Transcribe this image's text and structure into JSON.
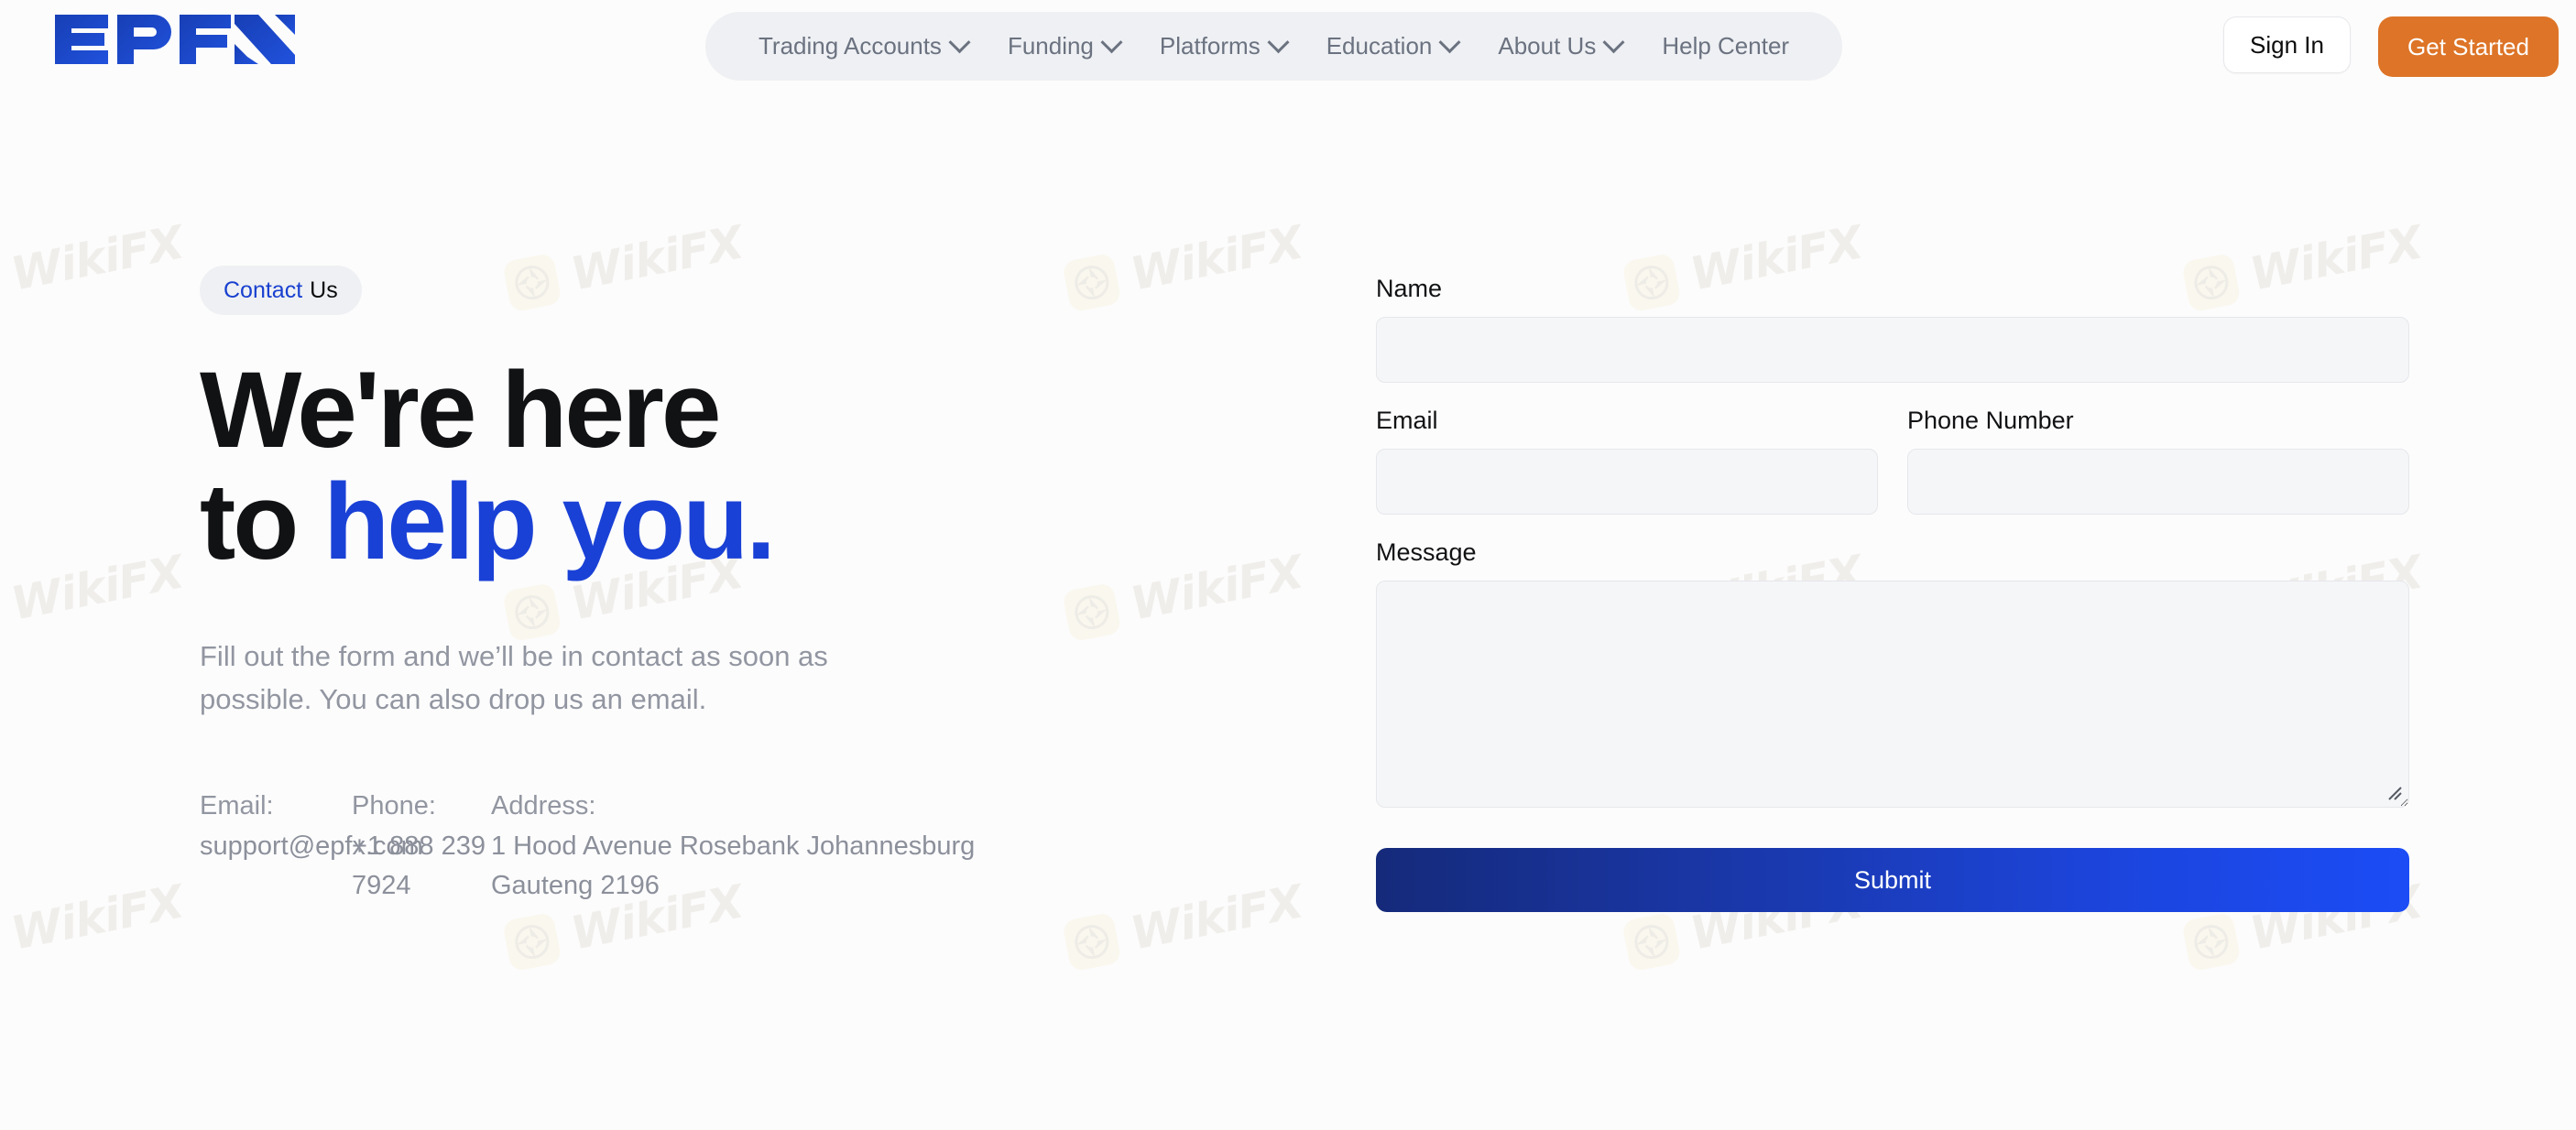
{
  "brand": {
    "logo_text": "EPFX",
    "logo_color": "#1B3FBE",
    "accent_blue": "#1A41D6",
    "accent_orange": "#DD7427",
    "page_background": "#FCFCFC"
  },
  "header": {
    "nav_items": [
      {
        "label": "Trading Accounts",
        "has_chevron": true,
        "icon": "chevron-down-icon"
      },
      {
        "label": "Funding",
        "has_chevron": true,
        "icon": "chevron-down-icon"
      },
      {
        "label": "Platforms",
        "has_chevron": true,
        "icon": "chevron-down-icon"
      },
      {
        "label": "Education",
        "has_chevron": true,
        "icon": "chevron-down-icon"
      },
      {
        "label": "About Us",
        "has_chevron": true,
        "icon": "chevron-down-icon"
      },
      {
        "label": "Help Center",
        "has_chevron": false,
        "icon": ""
      }
    ],
    "sign_in_label": "Sign In",
    "get_started_label": "Get Started"
  },
  "hero": {
    "badge_blue": "Contact",
    "badge_dark": "Us",
    "headline_line1": "We're here",
    "headline_line2_dark": "to ",
    "headline_line2_blue": "help you.",
    "subtext": "Fill out the form and we’ll be in contact as soon as possible. You can also drop us an email.",
    "details": [
      {
        "label": "Email:",
        "value": "support@epfx.com"
      },
      {
        "label": "Phone:",
        "value": "+1 888 239 7924"
      },
      {
        "label": "Address:",
        "value": "1 Hood Avenue Rosebank Johannesburg Gauteng 2196"
      }
    ]
  },
  "form": {
    "name_label": "Name",
    "name_value": "",
    "name_placeholder": "",
    "email_label": "Email",
    "email_value": "",
    "email_placeholder": "",
    "phone_label": "Phone Number",
    "phone_value": "",
    "phone_placeholder": "",
    "message_label": "Message",
    "message_value": "",
    "message_placeholder": "",
    "submit_label": "Submit"
  },
  "watermark": {
    "text": "WikiFX",
    "icon": "aperture-icon"
  }
}
